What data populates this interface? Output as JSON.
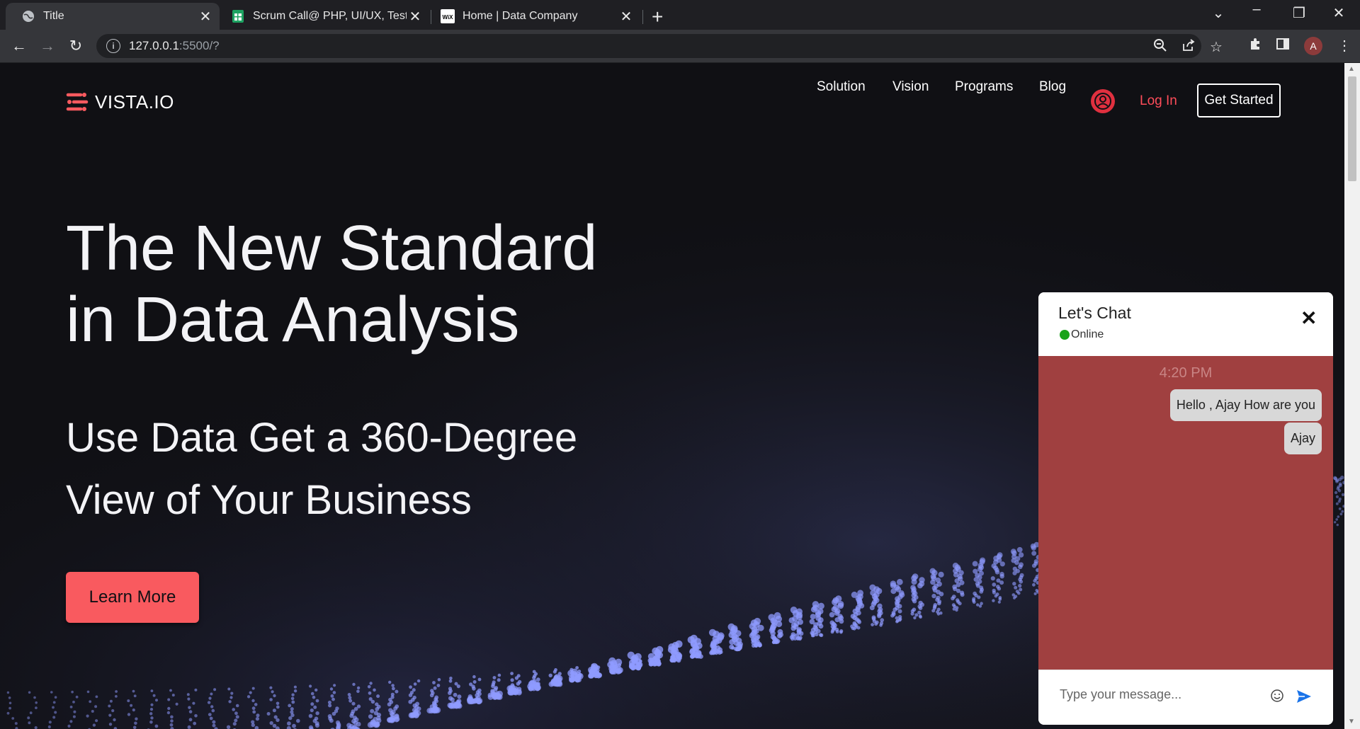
{
  "browser": {
    "tabs": [
      {
        "title": "Title",
        "icon": "globe-icon",
        "active": true
      },
      {
        "title": "Scrum Call@ PHP, UI/UX, Testing",
        "icon": "sheets-icon",
        "active": false
      },
      {
        "title": "Home | Data Company",
        "icon": "wix-icon",
        "active": false
      }
    ],
    "new_tab": "+",
    "url_host": "127.0.0.1",
    "url_rest": ":5500/?",
    "profile_initial": "A"
  },
  "site": {
    "brand": "VISTA.IO",
    "nav": [
      "Solution",
      "Vision",
      "Programs",
      "Blog"
    ],
    "login": "Log In",
    "get_started": "Get Started",
    "accent": "#f95a5f"
  },
  "hero": {
    "headline_line1": "The New Standard",
    "headline_line2": "in Data Analysis",
    "sub_line1": "Use Data Get a 360-Degree",
    "sub_line2": "View of Your Business",
    "cta": "Learn More"
  },
  "chat": {
    "title": "Let's Chat",
    "status": "Online",
    "timestamp": "4:20 PM",
    "messages": [
      "Hello , Ajay How are you",
      "Ajay"
    ],
    "input_placeholder": "Type your message...",
    "body_color": "#a04040"
  }
}
